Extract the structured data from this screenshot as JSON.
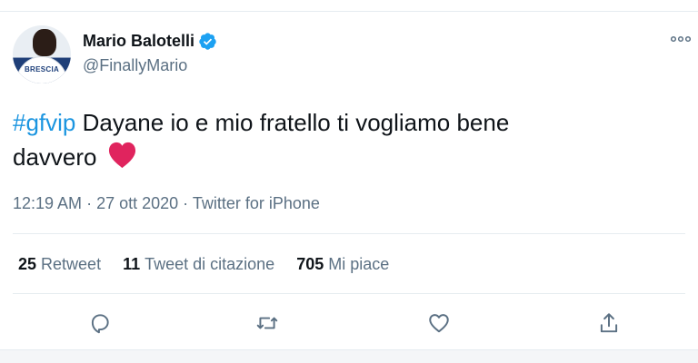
{
  "user": {
    "name": "Mario Balotelli",
    "handle": "@FinallyMario",
    "avatar_text": "BRESCIA",
    "verified": true
  },
  "tweet": {
    "hashtag": "#gfvip",
    "text_line1": " Dayane io e mio fratello ti vogliamo bene",
    "text_line2": "davvero",
    "emoji": "red-heart"
  },
  "meta": {
    "time": "12:19 AM",
    "date": "27 ott 2020",
    "source": "Twitter for iPhone",
    "separator": " · "
  },
  "stats": {
    "retweets": {
      "count": "25",
      "label": "Retweet"
    },
    "quotes": {
      "count": "11",
      "label": "Tweet di citazione"
    },
    "likes": {
      "count": "705",
      "label": "Mi piace"
    }
  },
  "colors": {
    "accent": "#1b95e0",
    "verified": "#1da1f2",
    "heart": "#e0245e",
    "muted": "#5b7083"
  }
}
